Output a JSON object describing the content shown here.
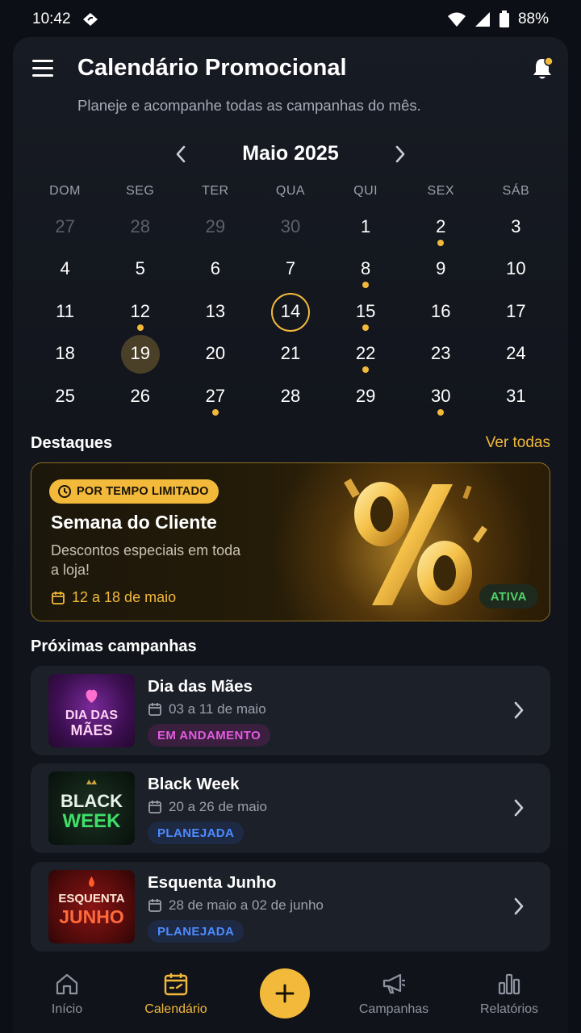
{
  "status_bar": {
    "time": "10:42",
    "battery": "88%"
  },
  "header": {
    "title": "Calendário Promocional",
    "subtitle": "Planeje e acompanhe todas as campanhas do mês."
  },
  "calendar": {
    "month_label": "Maio 2025",
    "weekdays": [
      "DOM",
      "SEG",
      "TER",
      "QUA",
      "QUI",
      "SEX",
      "SÁB"
    ],
    "days": [
      {
        "n": "27",
        "muted": true
      },
      {
        "n": "28",
        "muted": true
      },
      {
        "n": "29",
        "muted": true
      },
      {
        "n": "30",
        "muted": true
      },
      {
        "n": "1"
      },
      {
        "n": "2",
        "dot": true
      },
      {
        "n": "3"
      },
      {
        "n": "4"
      },
      {
        "n": "5"
      },
      {
        "n": "6"
      },
      {
        "n": "7"
      },
      {
        "n": "8",
        "dot": true
      },
      {
        "n": "9"
      },
      {
        "n": "10"
      },
      {
        "n": "11"
      },
      {
        "n": "12",
        "dot": true
      },
      {
        "n": "13"
      },
      {
        "n": "14",
        "today": true
      },
      {
        "n": "15",
        "dot": true
      },
      {
        "n": "16"
      },
      {
        "n": "17"
      },
      {
        "n": "18"
      },
      {
        "n": "19",
        "selected": true
      },
      {
        "n": "20"
      },
      {
        "n": "21"
      },
      {
        "n": "22",
        "dot": true
      },
      {
        "n": "23"
      },
      {
        "n": "24"
      },
      {
        "n": "25"
      },
      {
        "n": "26"
      },
      {
        "n": "27",
        "dot": true
      },
      {
        "n": "28"
      },
      {
        "n": "29"
      },
      {
        "n": "30",
        "dot": true
      },
      {
        "n": "31"
      }
    ]
  },
  "highlights": {
    "title": "Destaques",
    "see_all": "Ver todas",
    "promo": {
      "badge": "POR TEMPO LIMITADO",
      "title": "Semana do Cliente",
      "description": "Descontos especiais em toda a loja!",
      "dates": "12 a 18 de maio",
      "status": "ATIVA"
    }
  },
  "upcoming": {
    "title": "Próximas campanhas",
    "items": [
      {
        "name": "Dia das Mães",
        "dates": "03 a 11 de maio",
        "status": "EM ANDAMENTO",
        "thumb_line1": "DIA DAS",
        "thumb_line2": "MÃES"
      },
      {
        "name": "Black Week",
        "dates": "20 a 26 de maio",
        "status": "PLANEJADA",
        "thumb_line1": "BLACK",
        "thumb_line2": "WEEK"
      },
      {
        "name": "Esquenta Junho",
        "dates": "28 de maio a 02 de junho",
        "status": "PLANEJADA",
        "thumb_line1": "ESQUENTA",
        "thumb_line2": "JUNHO"
      }
    ]
  },
  "bottom_nav": {
    "home": "Início",
    "calendar": "Calendário",
    "campaigns": "Campanhas",
    "reports": "Relatórios"
  },
  "colors": {
    "accent": "#f2b93b",
    "background": "#0c0f15",
    "card": "#1c2029",
    "running": "#e25ce0",
    "planned": "#4d8bff",
    "active": "#4fd36a"
  }
}
